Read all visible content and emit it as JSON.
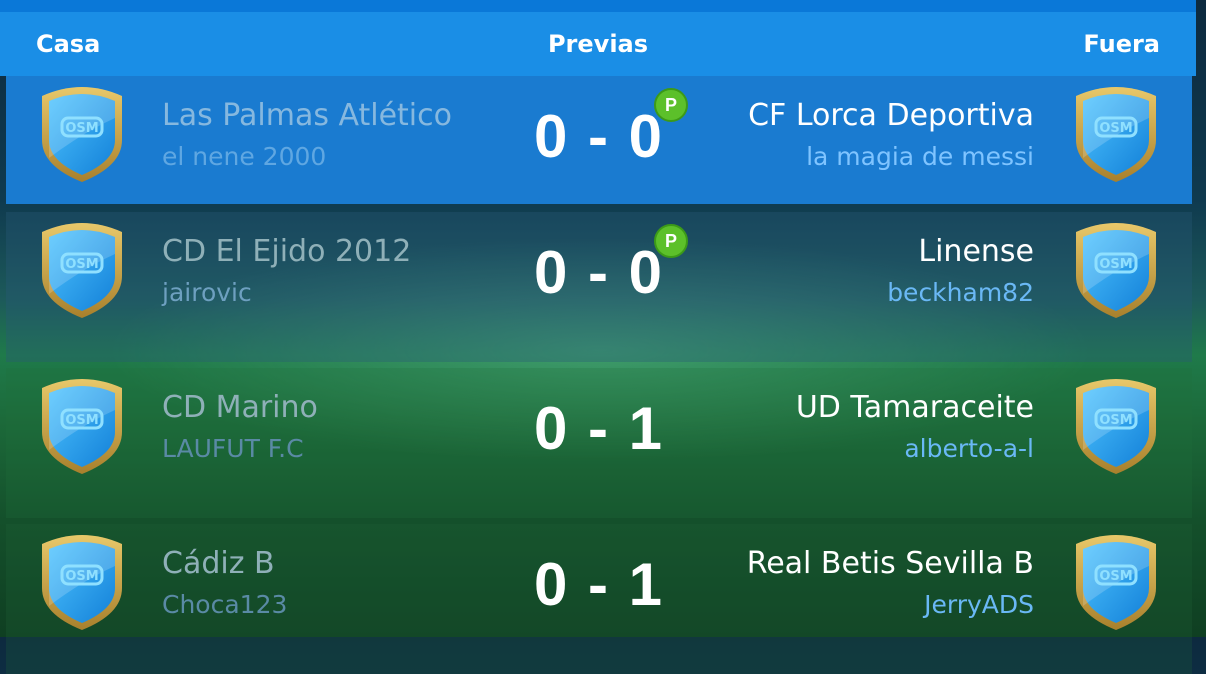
{
  "header": {
    "home": "Casa",
    "center": "Previas",
    "away": "Fuera"
  },
  "matches": [
    {
      "home_team": "Las Palmas Atlético",
      "home_user": "el nene 2000",
      "score": "0 - 0",
      "badge": "P",
      "away_team": "CF Lorca Deportiva",
      "away_user": "la magia de messi"
    },
    {
      "home_team": "CD El Ejido 2012",
      "home_user": "jairovic",
      "score": "0 - 0",
      "badge": "P",
      "away_team": "Linense",
      "away_user": "beckham82"
    },
    {
      "home_team": "CD Marino",
      "home_user": "LAUFUT F.C",
      "score": "0 - 1",
      "away_team": "UD Tamaraceite",
      "away_user": "alberto-a-l"
    },
    {
      "home_team": "Cádiz B",
      "home_user": "Choca123",
      "score": "0 - 1",
      "away_team": "Real Betis Sevilla B",
      "away_user": "JerryADS"
    }
  ],
  "colors": {
    "header": "#1a8ee6",
    "highlight_row": "#1a7bd0",
    "badge_green": "#5cc02a",
    "crest_gold": "#c9a64a"
  },
  "icons": {
    "crest": "osm-club-crest-icon",
    "pred": "prediction-badge-icon"
  }
}
